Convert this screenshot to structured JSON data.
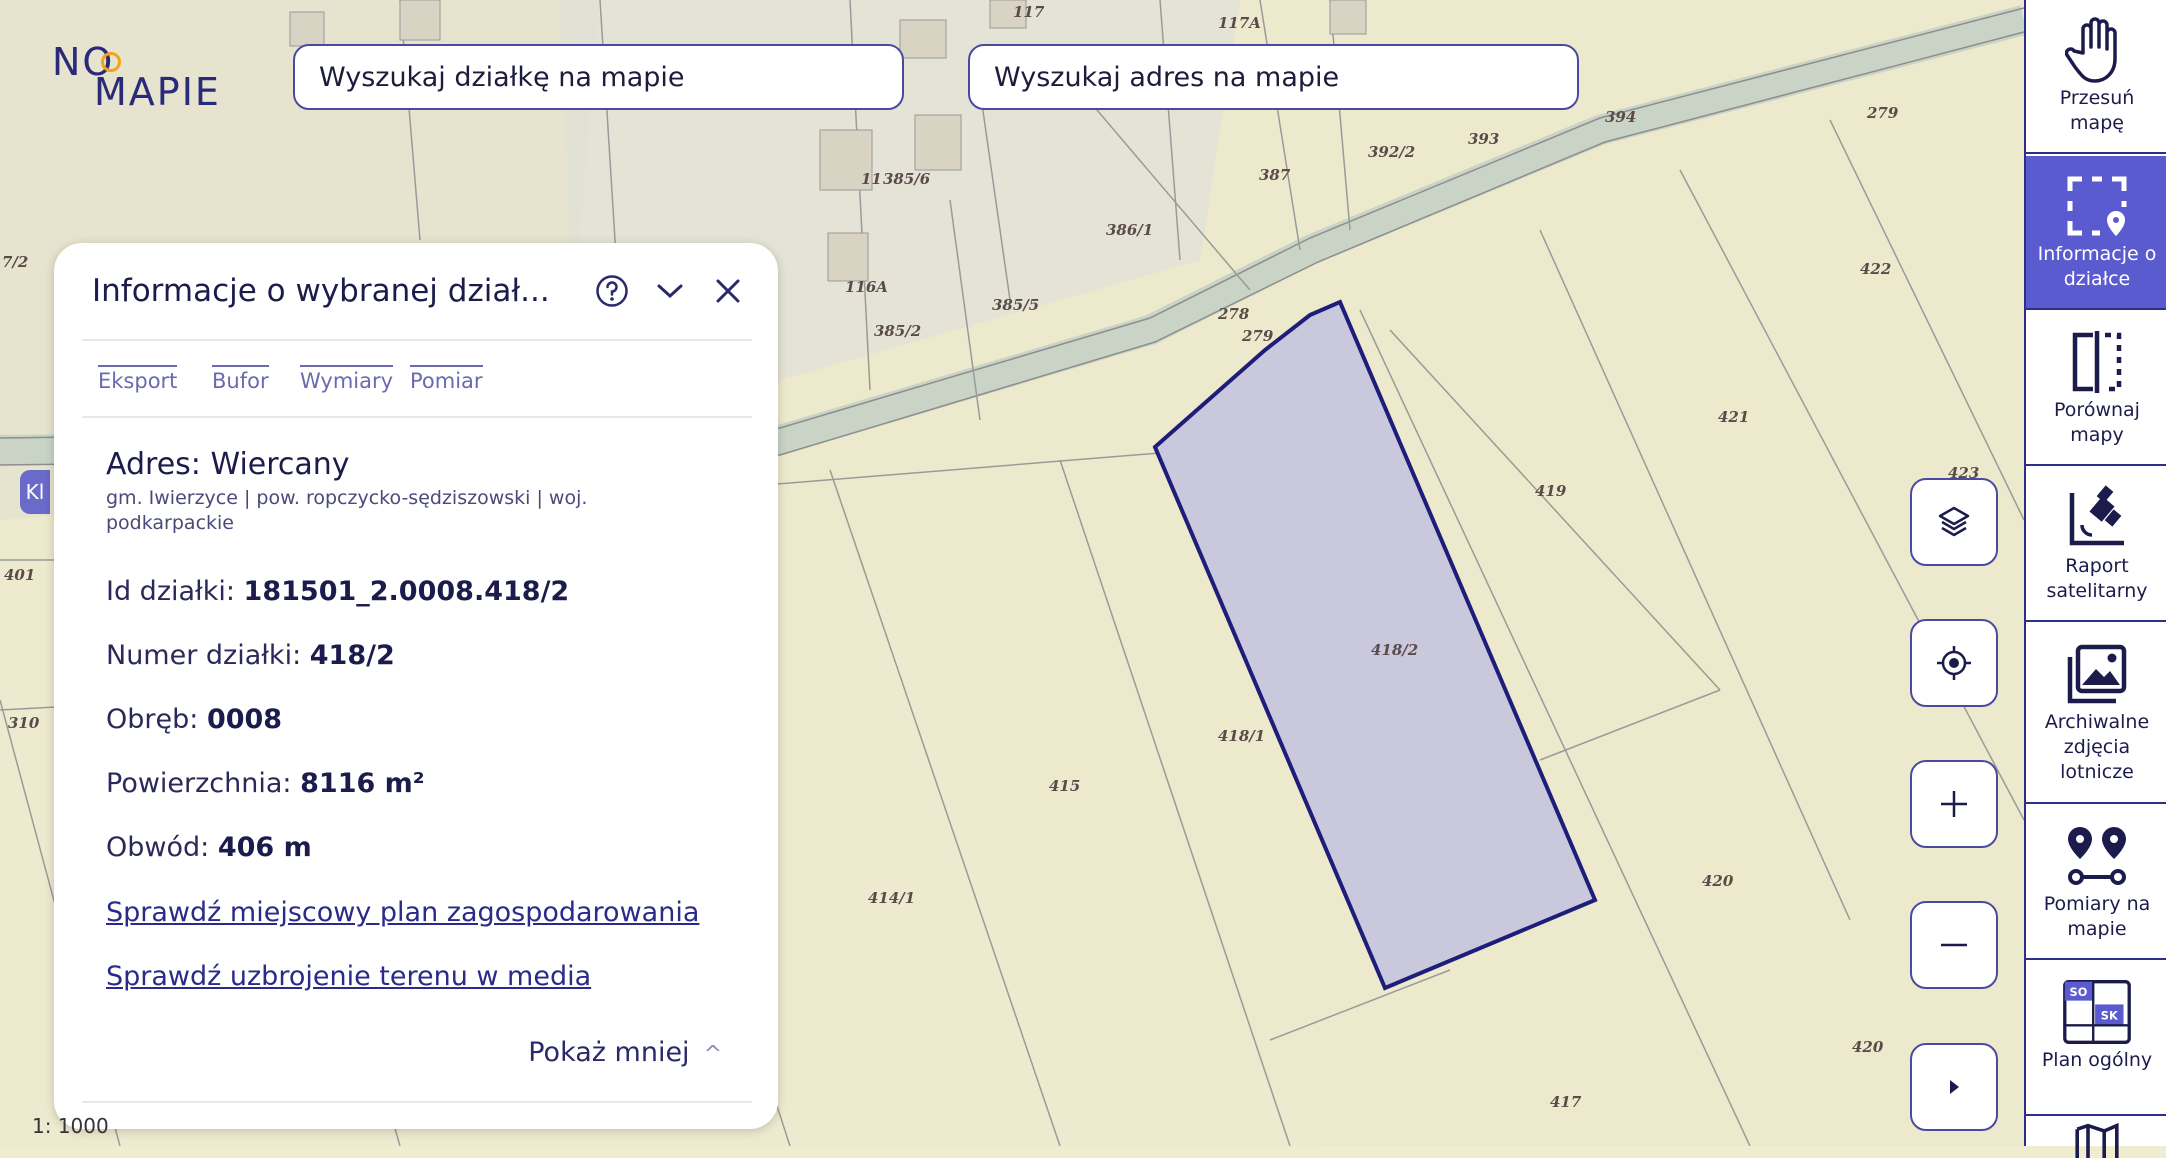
{
  "logo": {
    "line1": "NO",
    "line2": "MAPIE"
  },
  "search": {
    "parcel_placeholder": "Wyszukaj działkę na mapie",
    "address_placeholder": "Wyszukaj adres na mapie"
  },
  "map": {
    "parcel_labels": [
      "117",
      "117A",
      "394",
      "279",
      "393",
      "392/2",
      "387",
      "11",
      "385/6",
      "386/1",
      "422",
      "7/2",
      "116A",
      "385/5",
      "385/2",
      "278",
      "279",
      "421",
      "419",
      "423",
      "401",
      "418/2",
      "418/1",
      "310",
      "415",
      "420",
      "414/1",
      "420",
      "417"
    ],
    "scale": "1: 1000",
    "left_tag": "Kl"
  },
  "info_panel": {
    "title": "Informacje o wybranej dział...",
    "tabs": [
      "Eksport",
      "Bufor",
      "Wymiary",
      "Pomiar"
    ],
    "address": "Adres: Wiercany",
    "address_sub": "gm. Iwierzyce | pow. ropczycko-sędziszowski | woj. podkarpackie",
    "id_label": "Id działki:",
    "id_value": "181501_2.0008.418/2",
    "number_label": "Numer działki:",
    "number_value": "418/2",
    "precinct_label": "Obręb:",
    "precinct_value": "0008",
    "area_label": "Powierzchnia:",
    "area_value": "8116 m²",
    "perimeter_label": "Obwód:",
    "perimeter_value": "406 m",
    "link_plan": "Sprawdź miejscowy plan zagospodarowania",
    "link_media": "Sprawdź uzbrojenie terenu w media",
    "show_less": "Pokaż mniej"
  },
  "sidebar": {
    "items": [
      {
        "label": "Przesuń\nmapę",
        "icon": "hand-icon"
      },
      {
        "label": "Informacje o\ndziałce",
        "icon": "parcel-info-icon"
      },
      {
        "label": "Porównaj\nmapy",
        "icon": "compare-maps-icon"
      },
      {
        "label": "Raport\nsatelitarny",
        "icon": "satellite-icon"
      },
      {
        "label": "Archiwalne\nzdjęcia\nlotnicze",
        "icon": "photos-icon"
      },
      {
        "label": "Pomiary na\nmapie",
        "icon": "measure-icon"
      },
      {
        "label": "Plan ogólny",
        "icon": "general-plan-icon"
      }
    ],
    "plan_codes": [
      "SO",
      "SK"
    ]
  },
  "colors": {
    "accent": "#2d2d8a",
    "active": "#5b5bd0",
    "parcel_fill": "#c9c8dc",
    "map_bg": "#efeccf"
  }
}
